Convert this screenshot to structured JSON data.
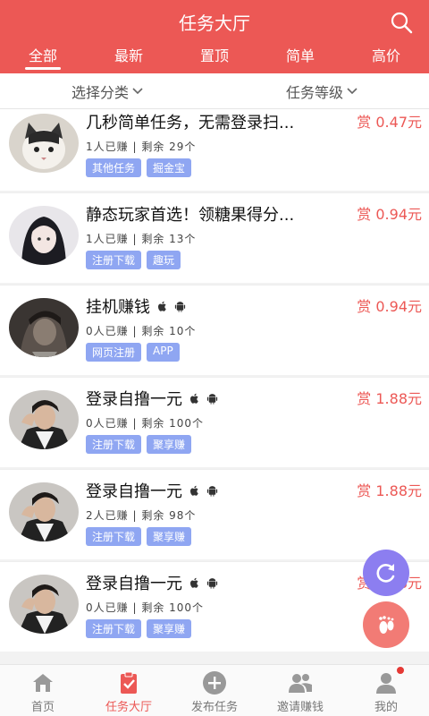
{
  "header": {
    "title": "任务大厅"
  },
  "tabs": [
    "全部",
    "最新",
    "置顶",
    "简单",
    "高价"
  ],
  "filters": {
    "category": "选择分类",
    "level": "任务等级"
  },
  "items": [
    {
      "title": "几秒简单任务，无需登录扫...",
      "reward": "赏 0.47元",
      "earned": "1人已赚",
      "remain": "剩余 29个",
      "tag1": "其他任务",
      "tag2": "掘金宝",
      "avatar": "cat-avatar",
      "os": false
    },
    {
      "title": "静态玩家首选！领糖果得分...",
      "reward": "赏 0.94元",
      "earned": "1人已赚",
      "remain": "剩余 13个",
      "tag1": "注册下载",
      "tag2": "趣玩",
      "avatar": "anime-girl-avatar",
      "os": false
    },
    {
      "title": "挂机赚钱",
      "reward": "赏 0.94元",
      "earned": "0人已赚",
      "remain": "剩余 10个",
      "tag1": "网页注册",
      "tag2": "APP",
      "avatar": "anime-boy-avatar",
      "os": true
    },
    {
      "title": "登录自撸一元",
      "reward": "赏 1.88元",
      "earned": "0人已赚",
      "remain": "剩余 100个",
      "tag1": "注册下载",
      "tag2": "聚享赚",
      "avatar": "man-avatar",
      "os": true
    },
    {
      "title": "登录自撸一元",
      "reward": "赏 1.88元",
      "earned": "2人已赚",
      "remain": "剩余 98个",
      "tag1": "注册下载",
      "tag2": "聚享赚",
      "avatar": "man-avatar",
      "os": true
    },
    {
      "title": "登录自撸一元",
      "reward": "赏 1.88元",
      "earned": "0人已赚",
      "remain": "剩余 100个",
      "tag1": "注册下载",
      "tag2": "聚享赚",
      "avatar": "man-avatar",
      "os": true
    }
  ],
  "bottom_nav": [
    {
      "label": "首页",
      "icon": "home-icon"
    },
    {
      "label": "任务大厅",
      "icon": "clipboard-icon"
    },
    {
      "label": "发布任务",
      "icon": "plus-icon"
    },
    {
      "label": "邀请赚钱",
      "icon": "users-icon"
    },
    {
      "label": "我的",
      "icon": "user-icon"
    }
  ],
  "colors": {
    "accent": "#ec5855",
    "tag": "#8fa6f2",
    "refresh_fab": "#8c7ef0",
    "feet_fab": "#f27b75"
  }
}
